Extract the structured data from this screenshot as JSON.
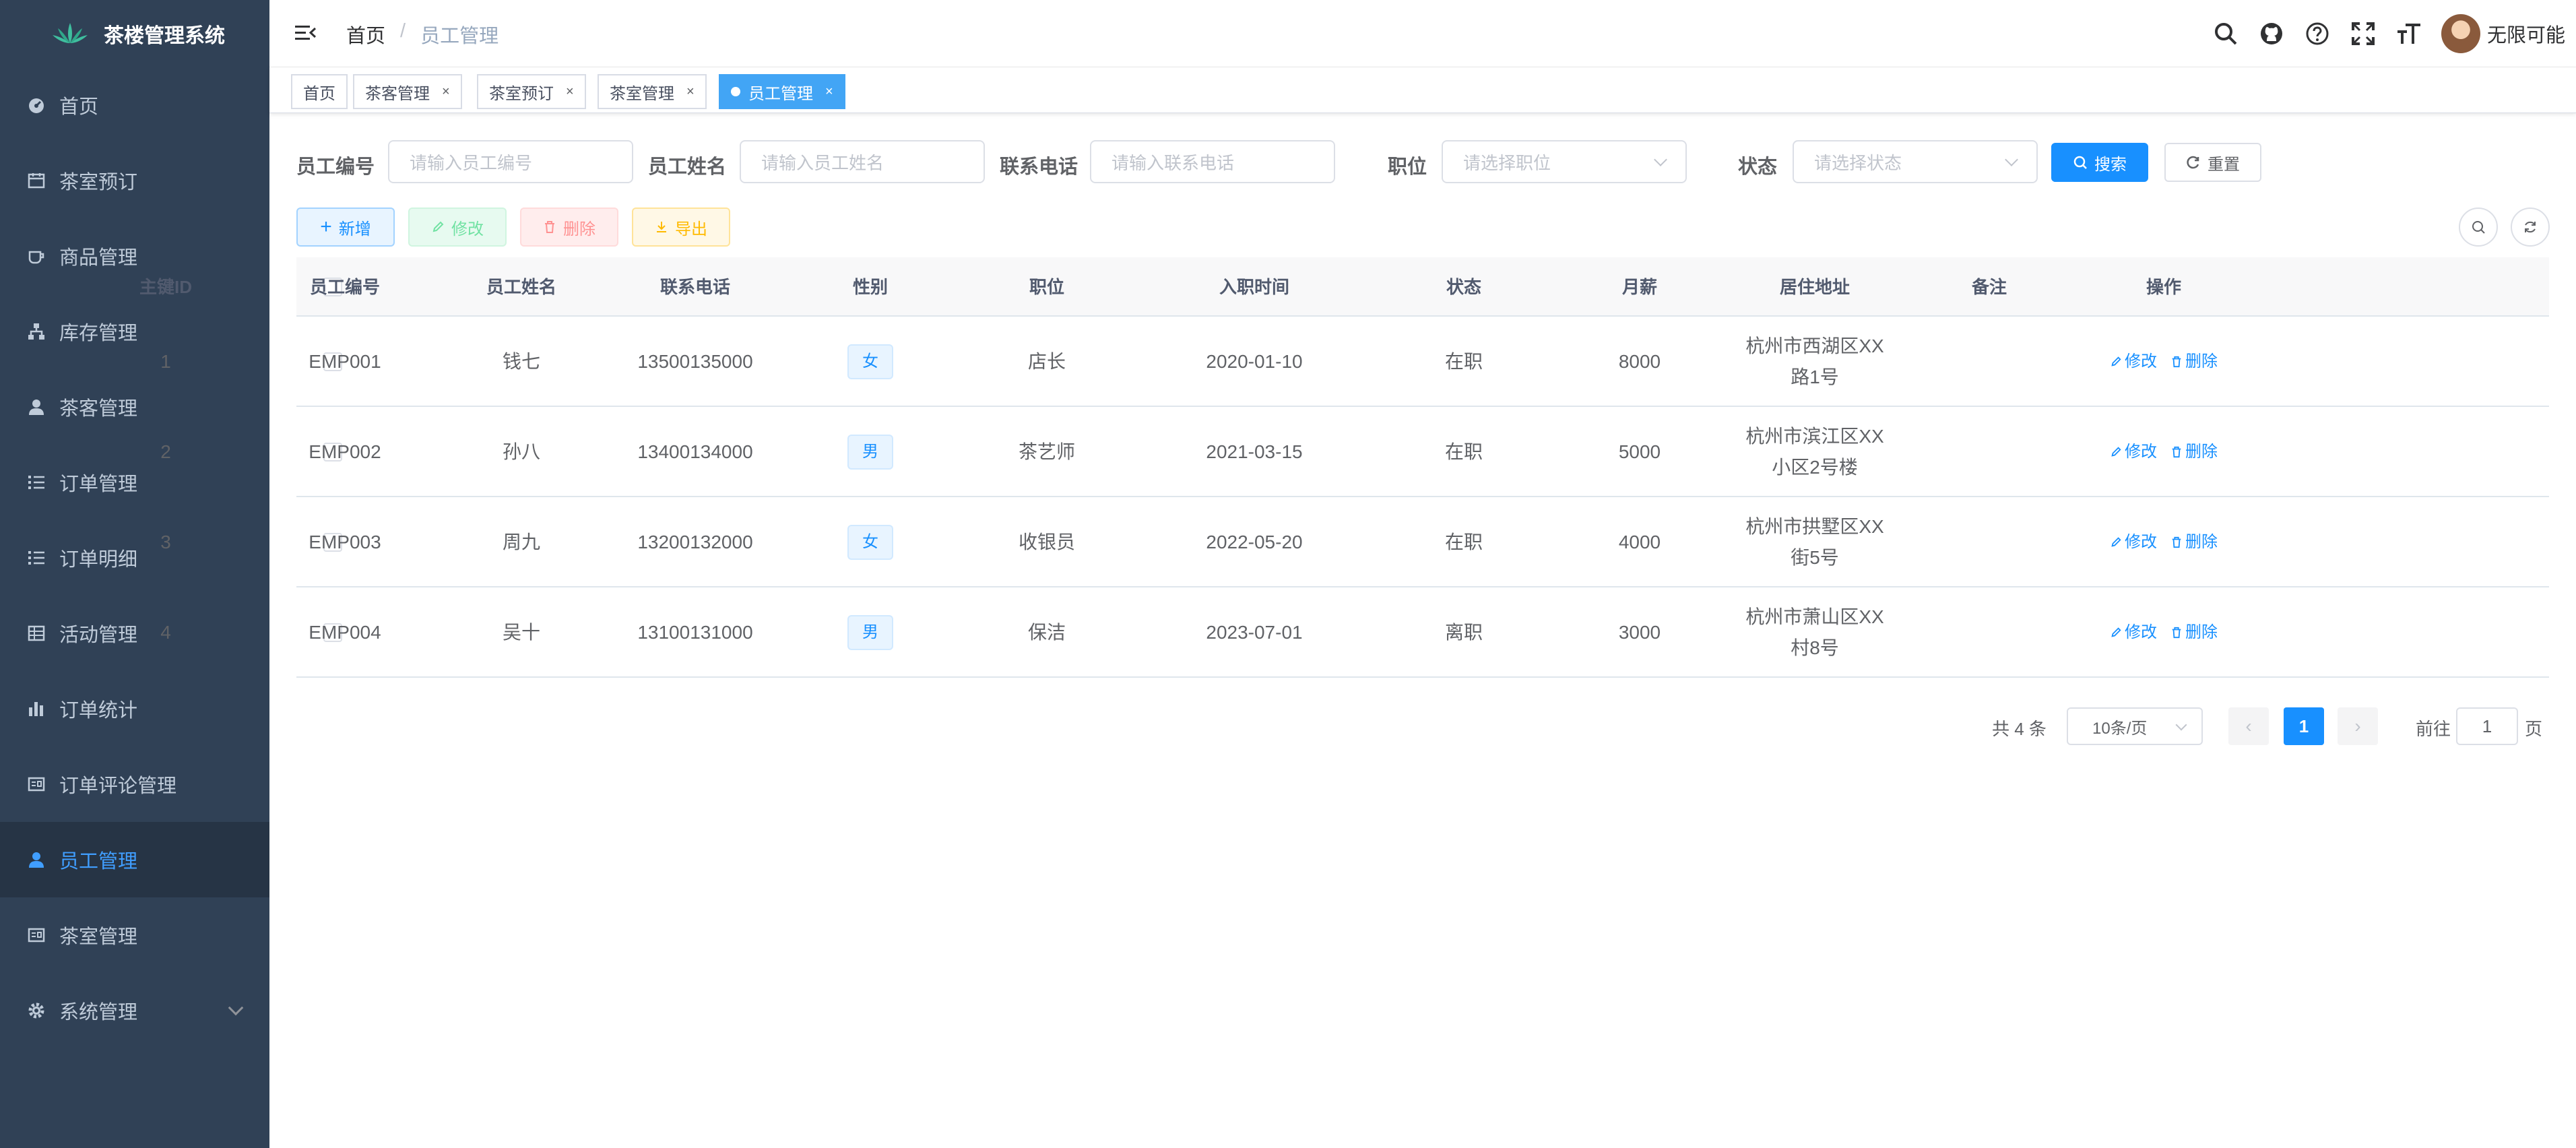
{
  "app": {
    "title": "茶楼管理系统"
  },
  "sidebar": {
    "items": [
      {
        "label": "首页",
        "icon": "dashboard-icon"
      },
      {
        "label": "茶室预订",
        "icon": "calendar-icon"
      },
      {
        "label": "商品管理",
        "icon": "cup-icon"
      },
      {
        "label": "库存管理",
        "icon": "tree-icon"
      },
      {
        "label": "茶客管理",
        "icon": "user-icon"
      },
      {
        "label": "订单管理",
        "icon": "list-icon"
      },
      {
        "label": "订单明细",
        "icon": "list-icon"
      },
      {
        "label": "活动管理",
        "icon": "table-icon"
      },
      {
        "label": "订单统计",
        "icon": "bar-chart-icon"
      },
      {
        "label": "订单评论管理",
        "icon": "message-icon"
      },
      {
        "label": "员工管理",
        "icon": "user-icon",
        "active": true
      },
      {
        "label": "茶室管理",
        "icon": "message-icon"
      },
      {
        "label": "系统管理",
        "icon": "gear-icon",
        "has_children": true
      }
    ]
  },
  "breadcrumb": {
    "home": "首页",
    "separator": "/",
    "current": "员工管理"
  },
  "user": {
    "name": "无限可能"
  },
  "tags": [
    {
      "label": "首页",
      "closable": false
    },
    {
      "label": "茶客管理",
      "closable": true
    },
    {
      "label": "茶室预订",
      "closable": true
    },
    {
      "label": "茶室管理",
      "closable": true
    },
    {
      "label": "员工管理",
      "closable": true,
      "active": true
    }
  ],
  "search": {
    "fields": [
      {
        "label": "员工编号",
        "placeholder": "请输入员工编号"
      },
      {
        "label": "员工姓名",
        "placeholder": "请输入员工姓名"
      },
      {
        "label": "联系电话",
        "placeholder": "请输入联系电话"
      },
      {
        "label": "职位",
        "placeholder": "请选择职位"
      },
      {
        "label": "状态",
        "placeholder": "请选择状态"
      }
    ],
    "search_label": "搜索",
    "reset_label": "重置"
  },
  "toolbar": {
    "add": "新增",
    "edit": "修改",
    "delete": "删除",
    "export": "导出"
  },
  "table": {
    "columns": [
      "主键ID",
      "员工编号",
      "员工姓名",
      "联系电话",
      "性别",
      "职位",
      "入职时间",
      "状态",
      "月薪",
      "居住地址",
      "备注",
      "操作"
    ],
    "rows": [
      {
        "id": "1",
        "code": "EMP001",
        "name": "钱七",
        "phone": "13500135000",
        "gender": "女",
        "position": "店长",
        "hire_date": "2020-01-10",
        "status": "在职",
        "salary": "8000",
        "address_line1": "杭州市西湖区XX",
        "address_line2": "路1号",
        "remark": ""
      },
      {
        "id": "2",
        "code": "EMP002",
        "name": "孙八",
        "phone": "13400134000",
        "gender": "男",
        "position": "茶艺师",
        "hire_date": "2021-03-15",
        "status": "在职",
        "salary": "5000",
        "address_line1": "杭州市滨江区XX",
        "address_line2": "小区2号楼",
        "remark": ""
      },
      {
        "id": "3",
        "code": "EMP003",
        "name": "周九",
        "phone": "13200132000",
        "gender": "女",
        "position": "收银员",
        "hire_date": "2022-05-20",
        "status": "在职",
        "salary": "4000",
        "address_line1": "杭州市拱墅区XX",
        "address_line2": "街5号",
        "remark": ""
      },
      {
        "id": "4",
        "code": "EMP004",
        "name": "吴十",
        "phone": "13100131000",
        "gender": "男",
        "position": "保洁",
        "hire_date": "2023-07-01",
        "status": "离职",
        "salary": "3000",
        "address_line1": "杭州市萧山区XX",
        "address_line2": "村8号",
        "remark": ""
      }
    ],
    "row_edit_label": "修改",
    "row_delete_label": "删除"
  },
  "pagination": {
    "total_text": "共 4 条",
    "page_size": "10条/页",
    "current_page": "1",
    "goto_prefix": "前往",
    "goto_value": "1",
    "goto_suffix": "页"
  },
  "colors": {
    "sidebar_bg": "#304156",
    "accent": "#1890ff",
    "active_tag": "#42a5f5"
  }
}
